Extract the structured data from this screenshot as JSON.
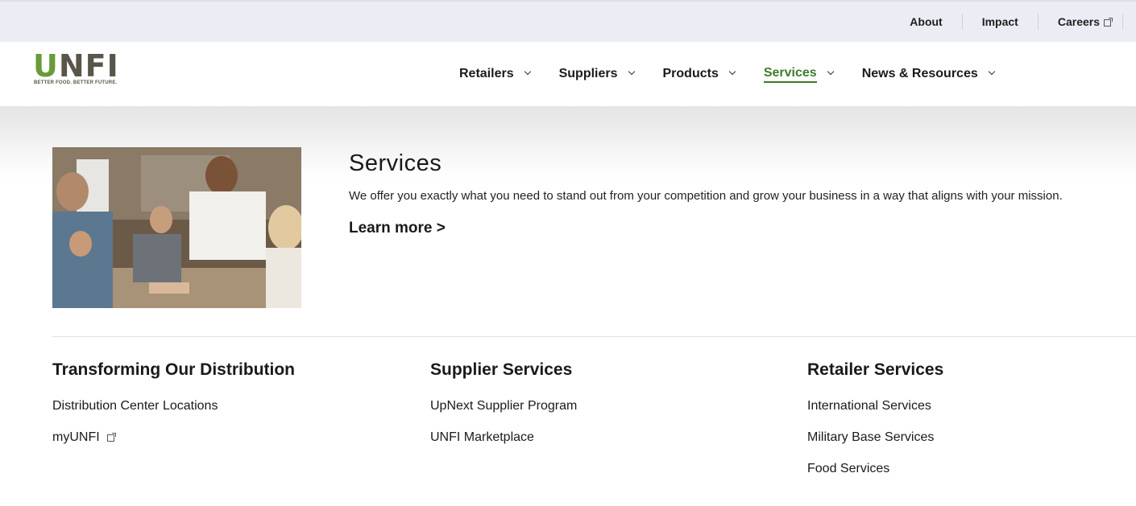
{
  "utility_nav": {
    "items": [
      {
        "label": "About",
        "external": false
      },
      {
        "label": "Impact",
        "external": false
      },
      {
        "label": "Careers",
        "external": true
      }
    ]
  },
  "brand": {
    "logo_text": "UNFI",
    "tagline": "BETTER FOOD. BETTER FUTURE.",
    "colors": {
      "logo_green": "#6a9a3a",
      "logo_gray": "#5a554a"
    }
  },
  "main_nav": {
    "items": [
      {
        "label": "Retailers"
      },
      {
        "label": "Suppliers"
      },
      {
        "label": "Products"
      },
      {
        "label": "Services",
        "active": true
      },
      {
        "label": "News & Resources"
      }
    ],
    "active_color": "#3e7b2a"
  },
  "mega_menu": {
    "title": "Services",
    "description": "We offer you exactly what you need to stand out from your competition and grow your business in a way that aligns with your mission.",
    "learn_more": "Learn more >",
    "columns": [
      {
        "title": "Transforming Our Distribution",
        "links": [
          {
            "label": "Distribution Center Locations",
            "external": false
          },
          {
            "label": "myUNFI",
            "external": true
          }
        ]
      },
      {
        "title": "Supplier Services",
        "links": [
          {
            "label": "UpNext Supplier Program",
            "external": false
          },
          {
            "label": "UNFI Marketplace",
            "external": false
          }
        ]
      },
      {
        "title": "Retailer Services",
        "links": [
          {
            "label": "International Services",
            "external": false
          },
          {
            "label": "Military Base Services",
            "external": false
          },
          {
            "label": "Food Services",
            "external": false
          }
        ]
      }
    ]
  }
}
